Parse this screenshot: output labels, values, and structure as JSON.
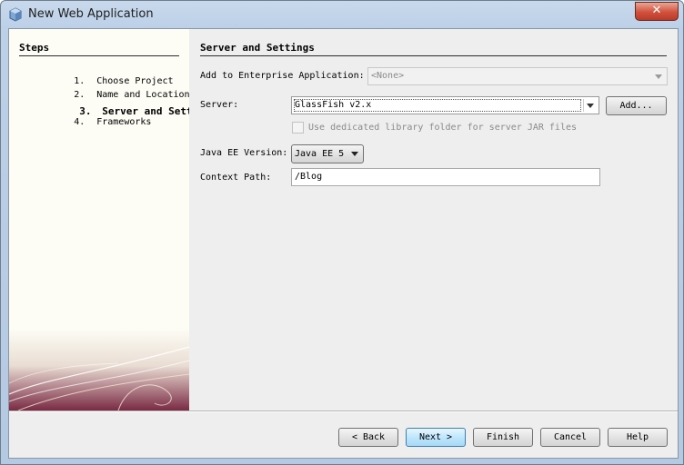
{
  "window": {
    "title": "New Web Application",
    "close_glyph": "✕",
    "icon": "app-cube-icon"
  },
  "steps": {
    "title": "Steps",
    "items": [
      {
        "num": "1.",
        "label": "Choose Project"
      },
      {
        "num": "2.",
        "label": "Name and Location"
      },
      {
        "num": "3.",
        "label": "Server and Settings"
      },
      {
        "num": "4.",
        "label": "Frameworks"
      }
    ],
    "current_index": 2
  },
  "panel": {
    "title": "Server and Settings",
    "enterprise_label": "Add to Enterprise Application:",
    "enterprise_value": "<None>",
    "server_label": "Server:",
    "server_value": "GlassFish v2.x",
    "add_button": "Add...",
    "checkbox_label": "Use dedicated library folder for server JAR files",
    "checkbox_checked": false,
    "javaee_label": "Java EE Version:",
    "javaee_value": "Java EE 5",
    "context_label": "Context Path:",
    "context_value": "/Blog"
  },
  "buttons": {
    "back": "< Back",
    "next": "Next >",
    "finish": "Finish",
    "cancel": "Cancel",
    "help": "Help"
  },
  "colors": {
    "accent": "#3c7fb1",
    "steps_bg": "#fdfdf5",
    "close": "#d1513d"
  }
}
